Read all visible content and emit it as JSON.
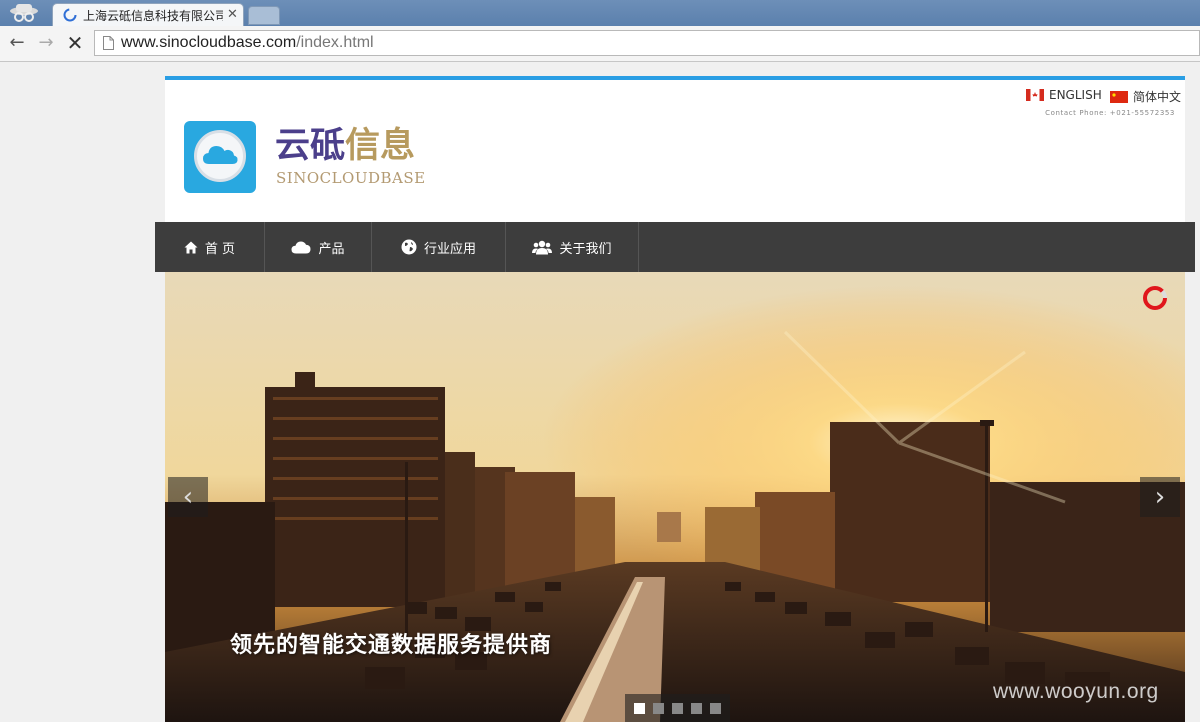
{
  "browser": {
    "tab_title": "上海云砥信息科技有限公司",
    "url_host": "www.sinocloudbase.com",
    "url_path": "/index.html"
  },
  "header": {
    "lang_english": "ENGLISH",
    "lang_chinese": "简体中文",
    "contact": "Contact Phone: +021-55572353",
    "logo_cn_part1": "云砥",
    "logo_cn_part2": "信息",
    "logo_en": "SINOCLOUDBASE"
  },
  "nav": {
    "items": [
      {
        "label": "首 页",
        "icon": "home-icon"
      },
      {
        "label": "产品",
        "icon": "cloud-icon"
      },
      {
        "label": "行业应用",
        "icon": "globe-icon"
      },
      {
        "label": "关于我们",
        "icon": "users-icon"
      }
    ]
  },
  "slider": {
    "caption": "领先的智能交通数据服务提供商",
    "prev_arrow": "‹",
    "next_arrow": "›",
    "active_slide": 1,
    "slide_count": 5
  },
  "watermark": "www.wooyun.org",
  "colors": {
    "accent_blue": "#2a9ee4",
    "logo_purple": "#4b3f8b",
    "logo_gold": "#b79a5e",
    "nav_bg": "#3d3d3d"
  }
}
